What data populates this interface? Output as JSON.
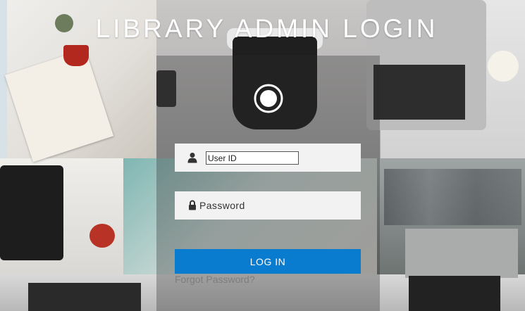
{
  "header": {
    "title": "LIBRARY ADMIN LOGIN"
  },
  "form": {
    "user_id": {
      "placeholder": "User ID",
      "value": ""
    },
    "password": {
      "placeholder": "Password",
      "value": ""
    },
    "login_label": "LOG IN",
    "forgot_label": "Forgot Password?"
  },
  "colors": {
    "accent": "#0a7ccf",
    "title": "#ffffff",
    "field_bg": "#f2f2f2"
  },
  "icons": {
    "logo": "circular-logo-icon",
    "user": "user-icon",
    "password": "lock-icon"
  }
}
